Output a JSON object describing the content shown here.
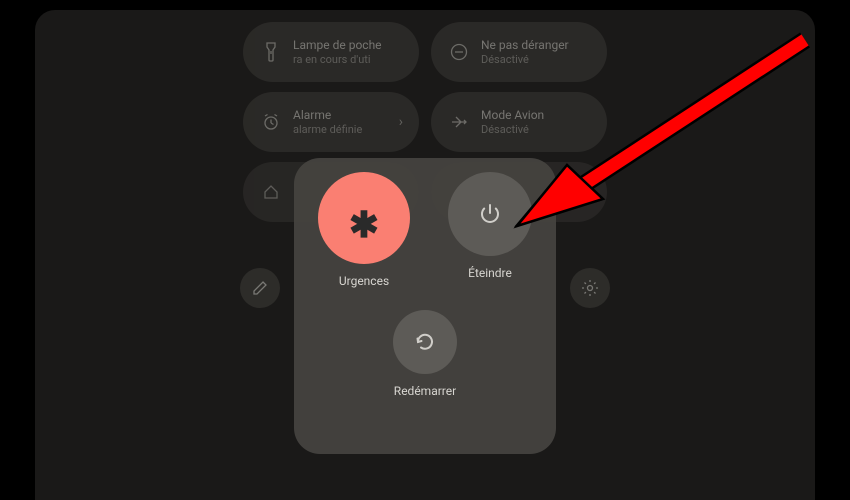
{
  "tiles": {
    "flashlight": {
      "title": "Lampe de poche",
      "sub": "ra en cours d'uti"
    },
    "dnd": {
      "title": "Ne pas déranger",
      "sub": "Désactivé"
    },
    "alarm": {
      "title": "Alarme",
      "sub": "alarme définie"
    },
    "airplane": {
      "title": "Mode Avion",
      "sub": "Désactivé"
    },
    "home": {
      "title": "",
      "sub": ""
    },
    "other": {
      "title": "",
      "sub": ""
    }
  },
  "power": {
    "emergency": "Urgences",
    "shutdown": "Éteindre",
    "restart": "Redémarrer"
  },
  "colors": {
    "emergency": "#fa7f72",
    "arrow": "#ff0000"
  }
}
